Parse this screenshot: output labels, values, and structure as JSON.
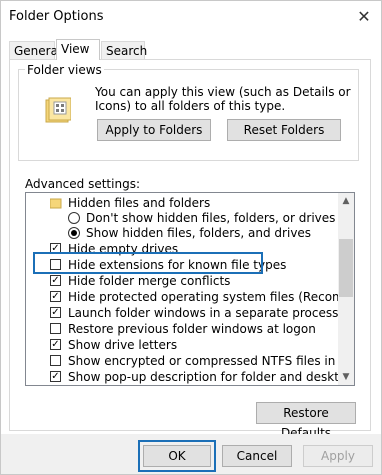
{
  "window": {
    "title": "Folder Options",
    "close_glyph": "✕"
  },
  "tabs": [
    {
      "label": "General"
    },
    {
      "label": "View"
    },
    {
      "label": "Search"
    }
  ],
  "folder_views": {
    "legend": "Folder views",
    "description": "You can apply this view (such as Details or Icons) to all folders of this type.",
    "apply_label": "Apply to Folders",
    "reset_label": "Reset Folders"
  },
  "advanced": {
    "label": "Advanced settings:",
    "items": [
      {
        "type": "folder",
        "label": "Hidden files and folders",
        "checked": false
      },
      {
        "type": "radio",
        "label": "Don't show hidden files, folders, or drives",
        "checked": false
      },
      {
        "type": "radio",
        "label": "Show hidden files, folders, and drives",
        "checked": true
      },
      {
        "type": "checkbox",
        "label": "Hide empty drives",
        "checked": true
      },
      {
        "type": "checkbox",
        "label": "Hide extensions for known file types",
        "checked": false
      },
      {
        "type": "checkbox",
        "label": "Hide folder merge conflicts",
        "checked": true
      },
      {
        "type": "checkbox",
        "label": "Hide protected operating system files (Recommended)",
        "checked": true
      },
      {
        "type": "checkbox",
        "label": "Launch folder windows in a separate process",
        "checked": true
      },
      {
        "type": "checkbox",
        "label": "Restore previous folder windows at logon",
        "checked": false
      },
      {
        "type": "checkbox",
        "label": "Show drive letters",
        "checked": true
      },
      {
        "type": "checkbox",
        "label": "Show encrypted or compressed NTFS files in color",
        "checked": false
      },
      {
        "type": "checkbox",
        "label": "Show pop-up description for folder and desktop items",
        "checked": true
      }
    ]
  },
  "restore_defaults_label": "Restore Defaults",
  "footer": {
    "ok_label": "OK",
    "cancel_label": "Cancel",
    "apply_label": "Apply"
  },
  "colors": {
    "highlight": "#1b6fb7",
    "folder": "#f5d67a"
  }
}
